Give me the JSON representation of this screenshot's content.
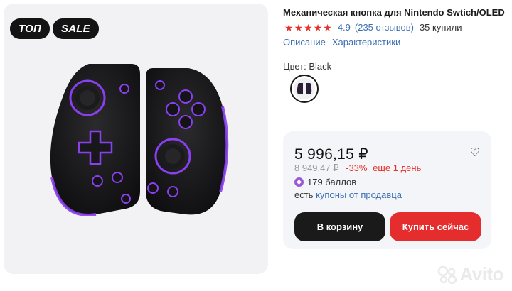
{
  "gallery": {
    "badges": [
      "ТОП",
      "SALE"
    ]
  },
  "product": {
    "title": "Механическая кнопка для Nintendo Swtich/OLED",
    "rating": {
      "stars": 5,
      "value": "4.9",
      "reviews": "(235 отзывов)",
      "bought": "35 купили"
    },
    "tabs": [
      "Описание",
      "Характеристики"
    ],
    "color_label": "Цвет: Black"
  },
  "price_card": {
    "price": "5 996,15 ₽",
    "old_price": "8 949,47 ₽",
    "discount": "-33%",
    "discount_note": "еще 1 день",
    "points": "179 баллов",
    "coupons_prefix": "есть",
    "coupons_link": "купоны от продавца",
    "cart_button": "В корзину",
    "buy_button": "Купить сейчас"
  },
  "watermark": {
    "text": "Avito"
  },
  "colors": {
    "accent_red": "#e52d2d",
    "link_blue": "#3b6fb3",
    "dark": "#1a1a1a",
    "glow_purple": "#8a3ff0"
  }
}
